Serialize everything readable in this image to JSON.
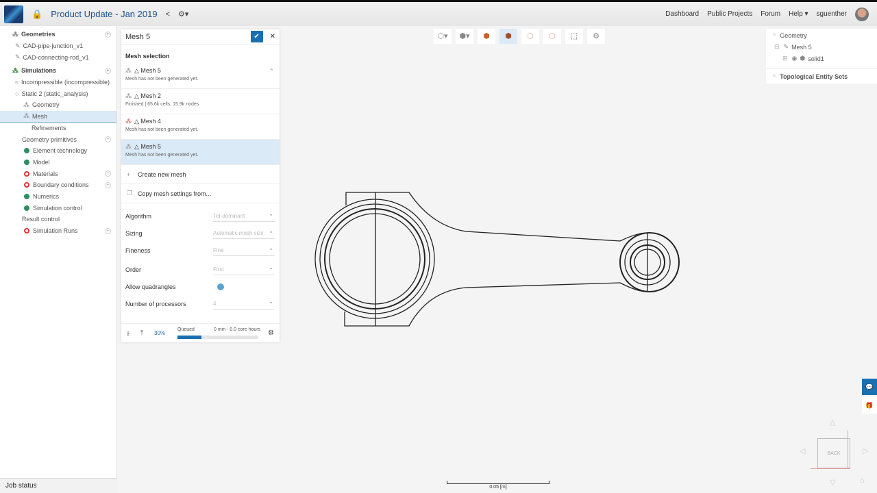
{
  "header": {
    "title": "Product Update - Jan 2019",
    "nav": [
      "Dashboard",
      "Public Projects",
      "Forum",
      "Help ▾",
      "sguenther"
    ]
  },
  "sidebar": {
    "geometries": "Geometries",
    "geom_items": [
      "CAD-pipe-junction_v1",
      "CAD-connecting-rod_v1"
    ],
    "simulations": "Simulations",
    "incompressible": "Incompressible (incompressible)",
    "static": "Static 2 (static_analysis)",
    "geometry": "Geometry",
    "mesh": "Mesh",
    "refinements": "Refinements",
    "primitives": "Geometry primitives",
    "items": [
      {
        "label": "Element technology",
        "status": "ok"
      },
      {
        "label": "Model",
        "status": "ok"
      },
      {
        "label": "Materials",
        "status": "error"
      },
      {
        "label": "Boundary conditions",
        "status": "error"
      },
      {
        "label": "Numerics",
        "status": "ok"
      },
      {
        "label": "Simulation control",
        "status": "ok"
      }
    ],
    "result_control": "Result control",
    "runs": "Simulation Runs",
    "job_status": "Job status"
  },
  "panel": {
    "title": "Mesh 5",
    "section": "Mesh selection",
    "meshes": [
      {
        "name": "△ Mesh 5",
        "status": "Mesh has not been generated yet."
      },
      {
        "name": "△ Mesh 2",
        "status": "Finished | 65.6k cells, 15.9k nodes"
      },
      {
        "name": "△ Mesh 4",
        "status": "Mesh has not been generated yet."
      },
      {
        "name": "△ Mesh 5",
        "status": "Mesh has not been generated yet."
      }
    ],
    "create": "Create new mesh",
    "copy": "Copy mesh settings from...",
    "fields": [
      {
        "label": "Algorithm",
        "value": "Tet-dominant"
      },
      {
        "label": "Sizing",
        "value": "Automatic mesh sizir"
      },
      {
        "label": "Fineness",
        "value": "Fine"
      },
      {
        "label": "Order",
        "value": "First"
      }
    ],
    "quad": "Allow quadrangles",
    "proc_label": "Number of processors",
    "proc_value": "4",
    "progress": {
      "percent": "30%",
      "value": 0.3,
      "state": "Queued",
      "time": "0 min - 0.0 core hours"
    }
  },
  "right": {
    "geometry": "Geometry",
    "mesh": "Mesh 5",
    "solid": "solid1",
    "topo": "Topological Entity Sets"
  },
  "viewcube": {
    "face": "BACK"
  },
  "scale": "0.05 [m]"
}
